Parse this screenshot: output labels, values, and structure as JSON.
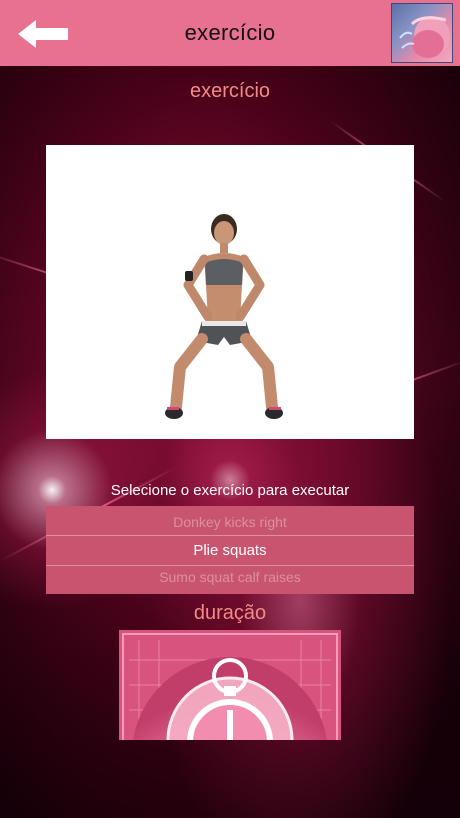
{
  "header": {
    "title": "exercício",
    "back_icon": "arrow-left-icon",
    "thumbnail_icon": "workout-thumbnail"
  },
  "section": {
    "exercise_title": "exercício",
    "duration_title": "duração"
  },
  "picker": {
    "prompt": "Selecione o exercício para executar",
    "options": [
      "Donkey kicks right",
      "Plie squats",
      "Sumo squat calf raises"
    ],
    "selected": "Plie squats"
  },
  "colors": {
    "header_bg": "#e8718f",
    "title_accent": "#f28b86",
    "picker_bg": "#c8546f"
  }
}
